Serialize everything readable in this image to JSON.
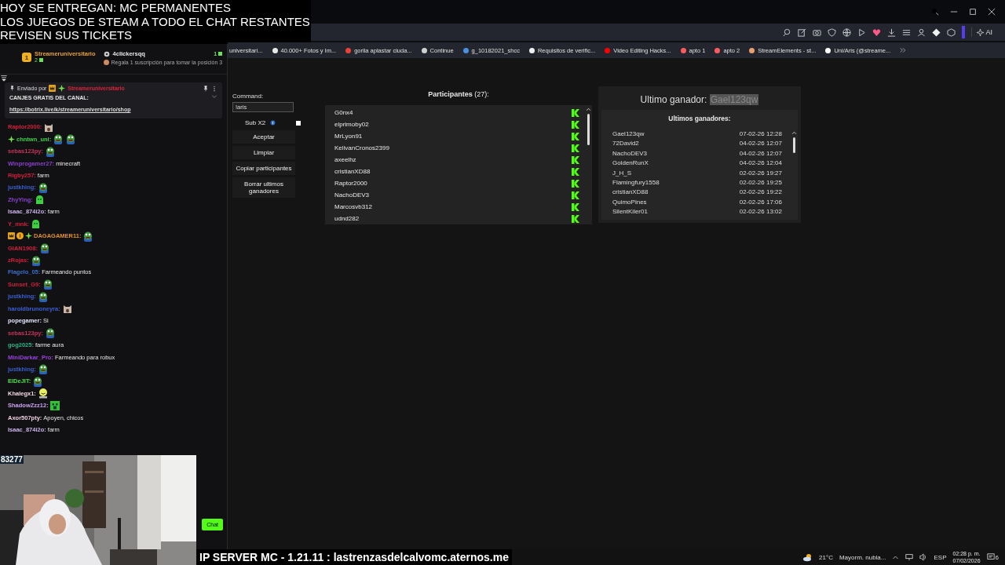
{
  "overlay_text": [
    "HOY SE ENTREGAN: MC PERMANENTES",
    "LOS JUEGOS DE STEAM A TODO EL CHAT RESTANTES",
    "REVISEN SUS TICKETS"
  ],
  "bookmarks": [
    {
      "label": "universitari..."
    },
    {
      "label": "40.000+ Fotos y Im...",
      "color": "#e8e8e8"
    },
    {
      "label": "gorila aplastar ciuda...",
      "color": "#ea4335"
    },
    {
      "label": "Continue",
      "color": "#d0d0d0"
    },
    {
      "label": "g_10182021_shcc",
      "color": "#4a90e2"
    },
    {
      "label": "Requisitos de verific...",
      "color": "#f0f0f0"
    },
    {
      "label": "Video Editing Hacks...",
      "color": "#ff0000"
    },
    {
      "label": "apto 1",
      "color": "#ff5a5f"
    },
    {
      "label": "apto 2",
      "color": "#ff5a5f"
    },
    {
      "label": "StreamElements - st...",
      "color": "#e8a070"
    },
    {
      "label": "Uni/Aris (@streame...",
      "color": "#ffffff"
    }
  ],
  "toolbar": {
    "ai_label": "AI"
  },
  "chat": {
    "leaderboard": [
      {
        "rank": "1",
        "name": "Streameruniversitario",
        "count": "2"
      },
      {
        "name": "4clickersqq",
        "count": "1"
      }
    ],
    "leaderboard_hint": "Regala 1 suscripción para tomar la posición 3",
    "pinned": {
      "prefix": "Enviado por",
      "author": "Streameruniversitario",
      "title": "CANJES GRATIS DEL CANAL:",
      "link": "https://botrix.live/k/streameruniversitario/shop"
    },
    "messages": [
      {
        "user": "Raptor2000:",
        "color": "#d0203c",
        "emotes": [
          {
            "kind": "cat"
          }
        ]
      },
      {
        "user": "chntwn_uni:",
        "color": "#3fd14a",
        "badges": [
          {
            "kind": "star"
          }
        ],
        "emotes": [
          {
            "kind": "frog"
          },
          {
            "kind": "frog"
          }
        ]
      },
      {
        "user": "sebas123py:",
        "color": "#c8335a",
        "emotes": [
          {
            "kind": "frog"
          }
        ]
      },
      {
        "user": "Winprogamer27:",
        "color": "#8a3fd1",
        "text": "minecraft"
      },
      {
        "user": "Rigby257:",
        "color": "#d0203c",
        "text": "farm"
      },
      {
        "user": "justkhing:",
        "color": "#3a5fd1",
        "emotes": [
          {
            "kind": "frog"
          }
        ]
      },
      {
        "user": "ZhyYing:",
        "color": "#8a3fd1",
        "emotes": [
          {
            "kind": "blob"
          }
        ]
      },
      {
        "user": "Isaac_874i2o:",
        "color": "#c9b3e8",
        "text": "farm"
      },
      {
        "user": "Y_mnk:",
        "color": "#d0203c",
        "emotes": [
          {
            "kind": "blob"
          }
        ]
      },
      {
        "user": "DAGAGAMER11:",
        "color": "#e0902a",
        "badges": [
          {
            "kind": "crown"
          },
          {
            "kind": "coin"
          },
          {
            "kind": "star"
          }
        ],
        "emotes": [
          {
            "kind": "frog"
          }
        ]
      },
      {
        "user": "GIAN1908:",
        "color": "#d0203c",
        "emotes": [
          {
            "kind": "frog"
          }
        ]
      },
      {
        "user": "zRojas:",
        "color": "#d0203c",
        "emotes": [
          {
            "kind": "frog"
          }
        ]
      },
      {
        "user": "Flagelo_05:",
        "color": "#3a6fd1",
        "text": "Farmeando puntos"
      },
      {
        "user": "Sunset_G9:",
        "color": "#d0203c",
        "emotes": [
          {
            "kind": "frog"
          }
        ]
      },
      {
        "user": "justkhing:",
        "color": "#3a5fd1",
        "emotes": [
          {
            "kind": "frog"
          }
        ]
      },
      {
        "user": "haroldbrunoneyra:",
        "color": "#3a5fd1",
        "emotes": [
          {
            "kind": "cat"
          }
        ]
      },
      {
        "user": "popegamer:",
        "color": "#e0e4ff",
        "text": "Si"
      },
      {
        "user": "sebas123py:",
        "color": "#c8335a",
        "emotes": [
          {
            "kind": "frog"
          }
        ]
      },
      {
        "user": "gog2025:",
        "color": "#2fb08a",
        "text": "farme aura"
      },
      {
        "user": "MiniDarkar_Pro:",
        "color": "#9a3fe0",
        "text": "Farmeando para robux"
      },
      {
        "user": "justkhing:",
        "color": "#3a5fd1",
        "emotes": [
          {
            "kind": "frog"
          }
        ]
      },
      {
        "user": "ElDeJIT:",
        "color": "#4ae04a",
        "emotes": [
          {
            "kind": "frog"
          }
        ]
      },
      {
        "user": "Khalegx1:",
        "color": "#f0d8e0",
        "emotes": [
          {
            "kind": "smiley"
          }
        ]
      },
      {
        "user": "ShadowZzz12:",
        "color": "#c9a0f0",
        "emotes": [
          {
            "kind": "block"
          }
        ]
      },
      {
        "user": "Axor507pty:",
        "color": "#f0d0e0",
        "text": "Apoyen, chicos"
      },
      {
        "user": "Isaac_874i2o:",
        "color": "#c9b3e8",
        "text": "farm"
      }
    ],
    "chat_button": "Chat"
  },
  "webcam": {
    "kind": "picture",
    "overlay_count": "83277"
  },
  "app": {
    "command_label": "Command:",
    "command_value": "!aris",
    "sub_label": "Sub X2",
    "sub_checked": false,
    "buttons": [
      "Aceptar",
      "Limpiar",
      "Copiar participantes",
      "Borrar ultimos ganadores"
    ],
    "participants_title": "Participantes",
    "participants_count": "(27):",
    "participants": [
      "G0nx4",
      "elprimoby02",
      "MrLyon91",
      "KelivanCronos2399",
      "axeelhz",
      "cristianXD88",
      "Raptor2000",
      "NachoDEV3",
      "Marcosvb312",
      "udnd282"
    ],
    "last_winner_label": "Ultimo ganador:",
    "last_winner": "Gael123qw",
    "winners_title": "Ultimos ganadores:",
    "winners": [
      {
        "name": "Gael123qw",
        "date": "07-02-26 12:28"
      },
      {
        "name": "72David2",
        "date": "04-02-26 12:07"
      },
      {
        "name": "NachoDEV3",
        "date": "04-02-26 12:07"
      },
      {
        "name": "GoldenRunX",
        "date": "04-02-26 12:04"
      },
      {
        "name": "J_H_S",
        "date": "02-02-26 19:27"
      },
      {
        "name": "Flamingfury1558",
        "date": "02-02-26 19:25"
      },
      {
        "name": "cristianXD88",
        "date": "02-02-26 19:22"
      },
      {
        "name": "QuimoPines",
        "date": "02-02-26 17:06"
      },
      {
        "name": "SilentKiler01",
        "date": "02-02-26 13:02"
      }
    ]
  },
  "taskbar": {
    "banner": "IP SERVER MC - 1.21.11 : lastrenzasdelcalvomc.aternos.me",
    "weather": "21°C",
    "weather_text": "Mayorm. nubla...",
    "language": "ESP",
    "time": "02:28 p. m.",
    "date": "07/02/2026",
    "notifications": "6"
  }
}
